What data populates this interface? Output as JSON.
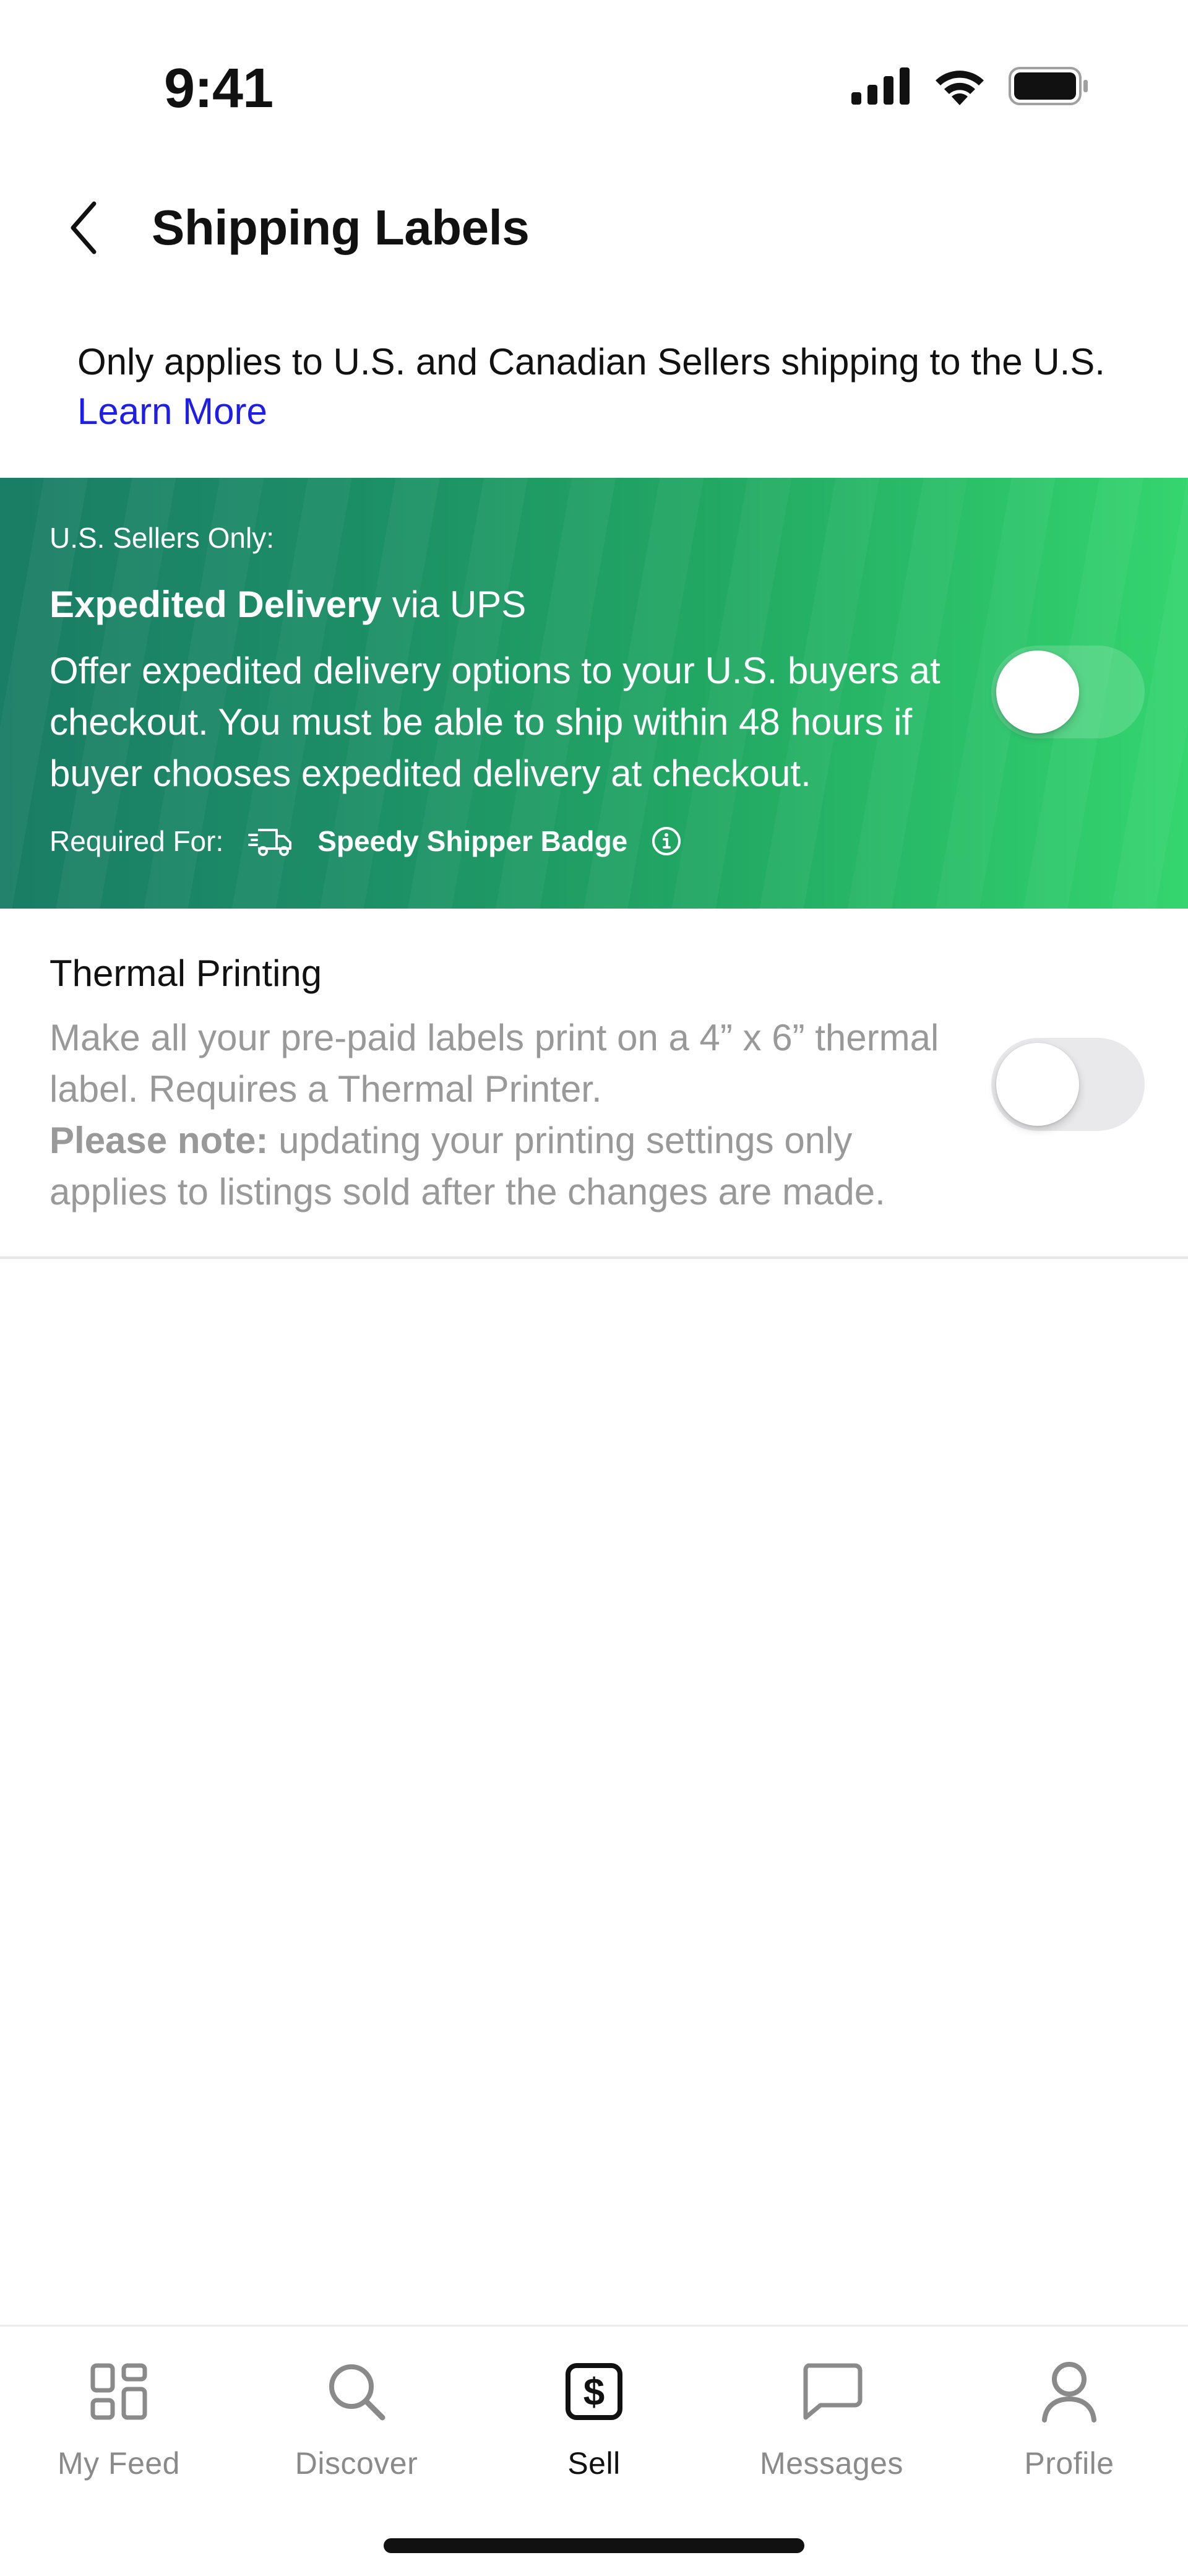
{
  "status_bar": {
    "time": "9:41"
  },
  "header": {
    "title": "Shipping Labels"
  },
  "info": {
    "text": "Only applies to U.S. and Canadian Sellers shipping to the U.S.",
    "learn_more": "Learn More"
  },
  "expedited": {
    "eyebrow": "U.S. Sellers Only:",
    "title_bold": "Expedited Delivery",
    "title_rest": " via UPS",
    "description": "Offer expedited delivery options to your U.S. buyers at checkout. You must be able to ship within 48 hours if buyer chooses expedited delivery at checkout.",
    "required_label": "Required For:",
    "badge_name": "Speedy Shipper Badge",
    "enabled": false
  },
  "thermal": {
    "title": "Thermal Printing",
    "description": "Make all your pre-paid labels print on a 4” x 6” thermal label. Requires a Thermal Printer.",
    "note_bold": "Please note:",
    "note_rest": " updating your printing settings only applies to listings sold after the changes are made.",
    "enabled": false
  },
  "tabs": [
    {
      "label": "My Feed",
      "icon": "grid-icon",
      "active": false
    },
    {
      "label": "Discover",
      "icon": "search-icon",
      "active": false
    },
    {
      "label": "Sell",
      "icon": "dollar-tag-icon",
      "active": true
    },
    {
      "label": "Messages",
      "icon": "chat-bubble-icon",
      "active": false
    },
    {
      "label": "Profile",
      "icon": "person-icon",
      "active": false
    }
  ],
  "colors": {
    "banner_start": "#1a7d65",
    "banner_end": "#35d56f",
    "link": "#1f1ee8",
    "muted_text": "#999999"
  }
}
